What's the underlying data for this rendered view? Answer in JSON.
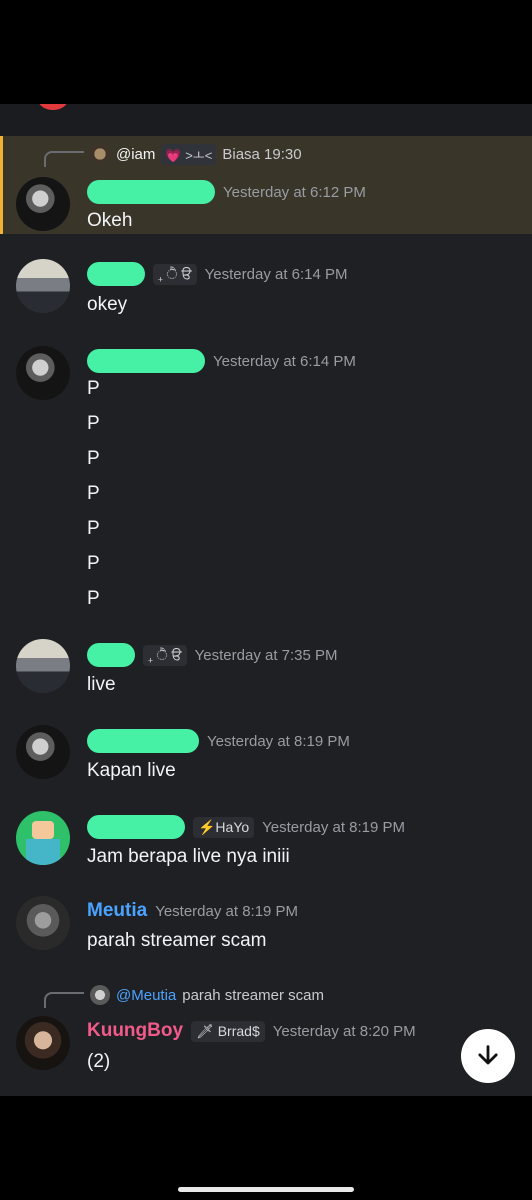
{
  "messages": {
    "m1": {
      "reply_user": "@iam",
      "reply_badge": "💗 >ㅗ<",
      "reply_text": "Biasa 19:30",
      "time": "Yesterday at 6:12 PM",
      "text": "Okeh"
    },
    "m2": {
      "name_suffix": "₊ ੈ ੳ",
      "time": "Yesterday at 6:14 PM",
      "text": "okey"
    },
    "m3": {
      "time": "Yesterday at 6:14 PM",
      "lines": [
        "P",
        "P",
        "P",
        "P",
        "P",
        "P",
        "P"
      ]
    },
    "m4": {
      "name_suffix": "₊ ੈ ੳ",
      "time": "Yesterday at 7:35 PM",
      "text": "live"
    },
    "m5": {
      "time": "Yesterday at 8:19 PM",
      "text": "Kapan live"
    },
    "m6": {
      "tag": "⚡HaYo",
      "time": "Yesterday at 8:19 PM",
      "text": "Jam berapa live nya iniii"
    },
    "m7": {
      "name": "Meutia",
      "time": "Yesterday at 8:19 PM",
      "text": "parah streamer scam"
    },
    "m8": {
      "reply_user": "@Meutia",
      "reply_text": "parah streamer scam",
      "name": "KuungBoy",
      "tag": "🗡 Brrad$",
      "time": "Yesterday at 8:20 PM",
      "text": "(2)"
    }
  },
  "colors": {
    "background": "#1f2024",
    "highlight": "#3a3529",
    "meutia": "#4aa3ff",
    "kuungboy": "#f25a8a",
    "redact": "#46f1a6"
  },
  "icons": {
    "scroll": "arrow-down-icon"
  }
}
